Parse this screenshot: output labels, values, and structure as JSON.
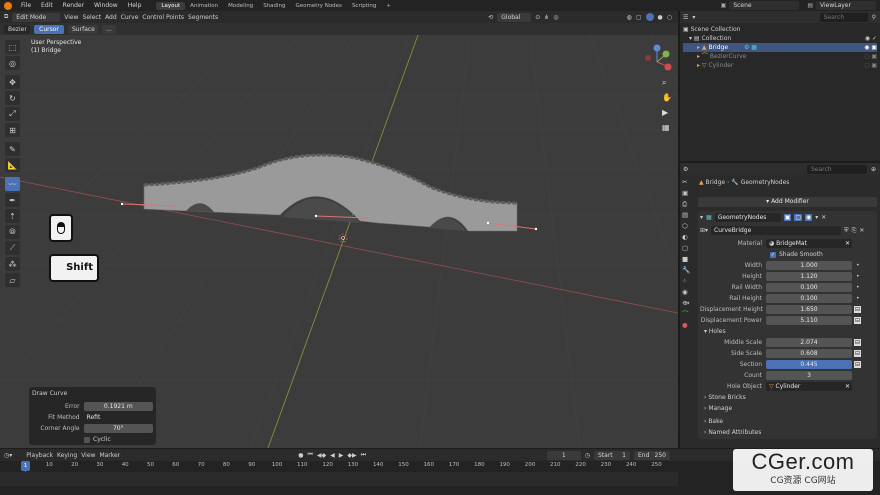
{
  "menu": {
    "items": [
      "File",
      "Edit",
      "Render",
      "Window",
      "Help"
    ]
  },
  "workspaces": {
    "tabs": [
      "Layout",
      "Animation",
      "Modeling",
      "Shading",
      "Geometry Nodes",
      "Scripting"
    ],
    "add": "+"
  },
  "scene": {
    "name": "Scene",
    "view_layer": "ViewLayer"
  },
  "viewport_header": {
    "mode": "Edit Mode",
    "menus": [
      "View",
      "Select",
      "Add",
      "Curve",
      "Control Points",
      "Segments"
    ],
    "orientation": "Global"
  },
  "tool_header": {
    "curve_type": "Bezier",
    "cursor": "Cursor",
    "surface": "Surface",
    "more": "..."
  },
  "viewport": {
    "perspective": "User Perspective",
    "object": "(1) Bridge"
  },
  "keys": {
    "mouse": "mouse",
    "shift": "Shift"
  },
  "last_operator": {
    "title": "Draw Curve",
    "error_label": "Error",
    "error_value": "0.1921 m",
    "fit_label": "Fit Method",
    "fit_value": "Refit",
    "corner_label": "Corner Angle",
    "corner_value": "70°",
    "cyclic_label": "Cyclic"
  },
  "outliner": {
    "search_placeholder": "Search",
    "scene_collection": "Scene Collection",
    "collection": "Collection",
    "items": [
      "Bridge",
      "BezierCurve",
      "Cylinder"
    ]
  },
  "properties": {
    "search_placeholder": "Search",
    "breadcrumb_object": "Bridge",
    "breadcrumb_modifier": "GeometryNodes",
    "add_modifier": "Add Modifier",
    "modifier_name": "GeometryNodes",
    "node_group": "CurveBridge",
    "material_label": "Material",
    "material_value": "BridgeMat",
    "shade_smooth": "Shade Smooth",
    "fields": [
      {
        "label": "Width",
        "value": "1.000"
      },
      {
        "label": "Height",
        "value": "1.120"
      },
      {
        "label": "Rail Width",
        "value": "0.100"
      },
      {
        "label": "Rail Height",
        "value": "0.100"
      },
      {
        "label": "Displacement Height",
        "value": "1.650"
      },
      {
        "label": "Displacement Power",
        "value": "5.110"
      }
    ],
    "holes_section": "Holes",
    "holes_fields": [
      {
        "label": "Middle Scale",
        "value": "2.074"
      },
      {
        "label": "Side Scale",
        "value": "0.608"
      },
      {
        "label": "Section",
        "value": "0.445"
      },
      {
        "label": "Count",
        "value": "3"
      }
    ],
    "hole_object_label": "Hole Object",
    "hole_object_value": "Cylinder",
    "subpanels": [
      "Stone Bricks",
      "Manage",
      "Bake",
      "Named Attributes"
    ]
  },
  "timeline": {
    "menus": [
      "Playback",
      "Keying",
      "View",
      "Marker"
    ],
    "current_frame": "1",
    "start_label": "Start",
    "start_value": "1",
    "end_label": "End",
    "end_value": "250",
    "ticks": [
      "0",
      "10",
      "20",
      "30",
      "40",
      "50",
      "60",
      "70",
      "80",
      "90",
      "100",
      "110",
      "120",
      "130",
      "140",
      "150",
      "160",
      "170",
      "180",
      "190",
      "200",
      "210",
      "220",
      "230",
      "240",
      "250"
    ]
  },
  "watermark": {
    "main": "CGer.com",
    "sub": "CG资源 CG网站"
  },
  "colors": {
    "accent": "#4a72b5",
    "orange": "#e87d0d",
    "viewport_bg": "#3c3c3c",
    "panel_bg": "#2b2b2b"
  }
}
